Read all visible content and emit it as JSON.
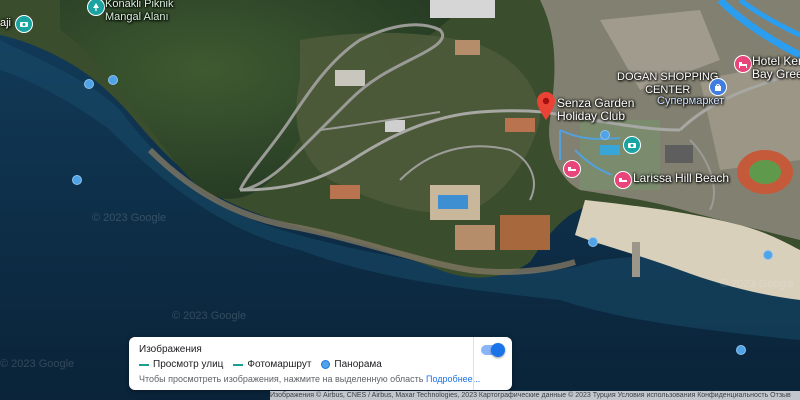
{
  "map": {
    "view": "satellite",
    "water_color": "#0b2a44",
    "labels": {
      "piknik": "Konakli Piknik\nMangal Alanı",
      "edge_left": "aji",
      "hotel": "Hotel Ken\nBay Green",
      "dogan": "DOGAN SHOPPING\nCENTER",
      "supermarket": "Супермаркет",
      "senza": "Senza Garden\nHoliday Club",
      "larissa": "Larissa Hill Beach"
    },
    "watermarks": [
      "© 2023 Google",
      "© 2023 Google",
      "© 2023 Google",
      "© 2023 Google"
    ],
    "icons": {
      "piknik_icon": "tree-icon",
      "aji_icon": "camera-icon",
      "hotel_icon": "bed-icon",
      "dogan_icon": "shopping-bag-icon",
      "senza_pin": "location-pin-icon",
      "larissa_icon": "bed-icon",
      "hotel2_icon": "bed-icon",
      "photo_icon": "camera-icon"
    }
  },
  "layer_panel": {
    "title": "Изображения",
    "legend": {
      "street_view": "Просмотр улиц",
      "photo_route": "Фотомаршрут",
      "panorama": "Панорама"
    },
    "hint": "Чтобы просмотреть изображения, нажмите на выделенную область",
    "hint_link": "Подробнее...",
    "toggle_on": true
  },
  "attribution": "Изображения © Airbus, CNES / Airbus, Maxar Technologies, 2023 Картографические данные ©   2023   Турция   Условия использования   Конфиденциальность   Отзыв"
}
